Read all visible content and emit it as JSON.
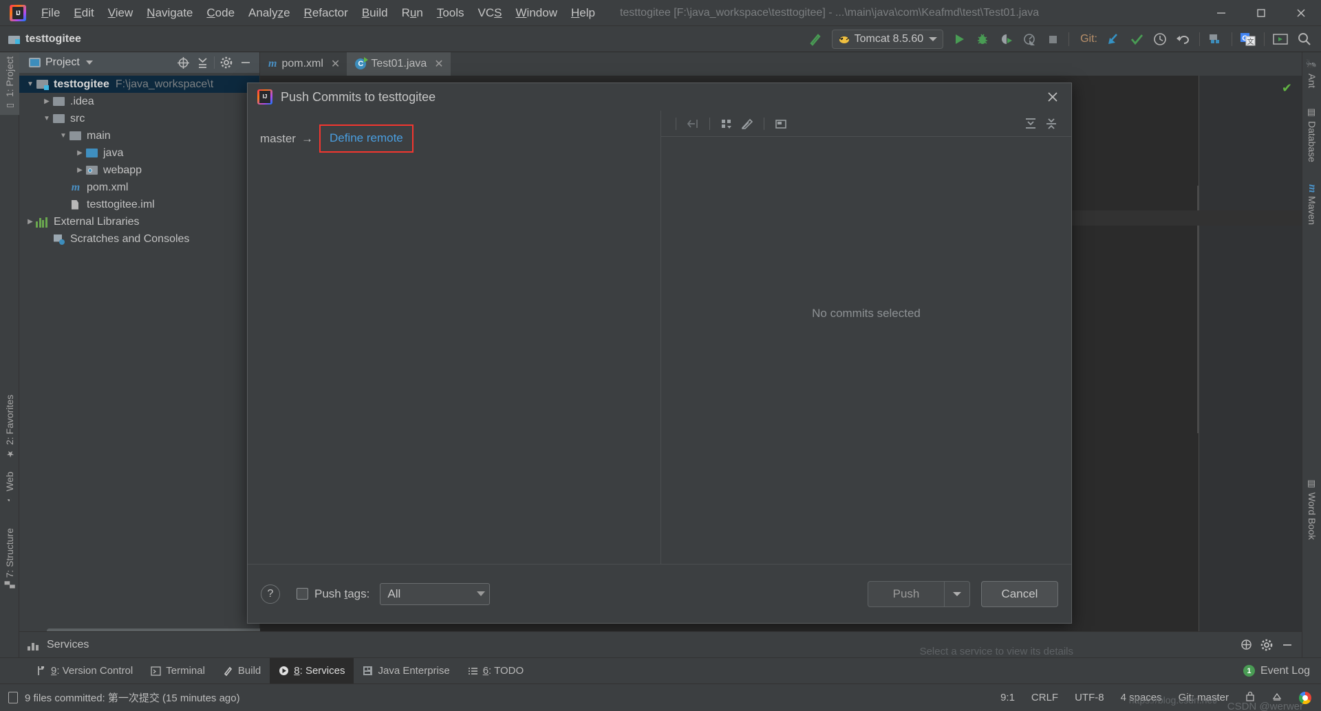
{
  "menu": {
    "items": [
      {
        "label": "File",
        "mn": "F"
      },
      {
        "label": "Edit",
        "mn": "E"
      },
      {
        "label": "View",
        "mn": "V"
      },
      {
        "label": "Navigate",
        "mn": "N"
      },
      {
        "label": "Code",
        "mn": "C"
      },
      {
        "label": "Analyze",
        "mn": "z"
      },
      {
        "label": "Refactor",
        "mn": "R"
      },
      {
        "label": "Build",
        "mn": "B"
      },
      {
        "label": "Run",
        "mn": "u"
      },
      {
        "label": "Tools",
        "mn": "T"
      },
      {
        "label": "VCS",
        "mn": "S"
      },
      {
        "label": "Window",
        "mn": "W"
      },
      {
        "label": "Help",
        "mn": "H"
      }
    ],
    "window_title": "testtogitee [F:\\java_workspace\\testtogitee] - ...\\main\\java\\com\\Keafmd\\test\\Test01.java",
    "window_controls": [
      "minimize",
      "maximize",
      "close"
    ]
  },
  "toolbar": {
    "project_name": "testtogitee",
    "run_config": "Tomcat 8.5.60",
    "git_label": "Git:",
    "icons": [
      "build-icon",
      "run-icon",
      "debug-icon",
      "run-coverage-icon",
      "profile-icon",
      "stop-icon"
    ],
    "git_icons": [
      "update-project-icon",
      "commit-icon",
      "history-icon",
      "undo-icon"
    ],
    "right_icons": [
      "project-structure-icon",
      "translate-icon",
      "terminal-icon",
      "search-icon"
    ]
  },
  "left_stripe": [
    {
      "label": "1: Project",
      "icon": "project-icon",
      "selected": true
    },
    {
      "label": "2: Favorites",
      "icon": "star-icon",
      "selected": false
    },
    {
      "label": "Web",
      "icon": "web-icon",
      "selected": false
    },
    {
      "label": "7: Structure",
      "icon": "structure-icon",
      "selected": false
    }
  ],
  "right_stripe": [
    {
      "label": "Ant",
      "icon": "ant-icon"
    },
    {
      "label": "Database",
      "icon": "database-icon"
    },
    {
      "label": "Maven",
      "icon": "maven-icon"
    },
    {
      "label": "Word Book",
      "icon": "wordbook-icon"
    }
  ],
  "project_panel": {
    "header_title": "Project",
    "header_icons": [
      "locate-icon",
      "collapse-all-icon",
      "settings-icon",
      "hide-icon"
    ],
    "tree": [
      {
        "label": "testtogitee",
        "path": "F:\\java_workspace\\t",
        "indent": 0,
        "arrow": "down",
        "icon": "project-folder-icon",
        "bold": true,
        "selected": true
      },
      {
        "label": ".idea",
        "path": "",
        "indent": 1,
        "arrow": "right",
        "icon": "folder-icon",
        "bold": false,
        "selected": false
      },
      {
        "label": "src",
        "path": "",
        "indent": 1,
        "arrow": "down",
        "icon": "folder-icon",
        "bold": false,
        "selected": false
      },
      {
        "label": "main",
        "path": "",
        "indent": 2,
        "arrow": "down",
        "icon": "folder-icon",
        "bold": false,
        "selected": false
      },
      {
        "label": "java",
        "path": "",
        "indent": 3,
        "arrow": "right",
        "icon": "source-folder-icon",
        "bold": false,
        "selected": false
      },
      {
        "label": "webapp",
        "path": "",
        "indent": 3,
        "arrow": "right",
        "icon": "webapp-folder-icon",
        "bold": false,
        "selected": false
      },
      {
        "label": "pom.xml",
        "path": "",
        "indent": 2,
        "arrow": "none",
        "icon": "maven-file-icon",
        "bold": false,
        "selected": false
      },
      {
        "label": "testtogitee.iml",
        "path": "",
        "indent": 2,
        "arrow": "none",
        "icon": "iml-file-icon",
        "bold": false,
        "selected": false
      },
      {
        "label": "External Libraries",
        "path": "",
        "indent": 0,
        "arrow": "right",
        "icon": "libraries-icon",
        "bold": false,
        "selected": false
      },
      {
        "label": "Scratches and Consoles",
        "path": "",
        "indent": 0,
        "arrow": "none",
        "icon": "scratches-icon",
        "bold": false,
        "selected": false
      }
    ]
  },
  "editor": {
    "tabs": [
      {
        "label": "pom.xml",
        "icon": "maven-file-icon",
        "active": false
      },
      {
        "label": "Test01.java",
        "icon": "java-class-icon",
        "active": true
      }
    ]
  },
  "dialog": {
    "title": "Push Commits to testtogitee",
    "close_icon": "close-icon",
    "branch_source": "master",
    "branch_arrow": "→",
    "define_remote_link": "Define remote",
    "commit_toolbar_icons": [
      "collapse-selection-icon",
      "grid-icon",
      "edit-icon",
      "preview-icon",
      "expand-all-icon",
      "collapse-all-icon"
    ],
    "empty_message": "No commits selected",
    "help_label": "?",
    "push_tags_label": "Push tags:",
    "push_tags_mnemonic": "t",
    "push_tags_checked": false,
    "tags_scope": "All",
    "push_button": "Push",
    "cancel_button": "Cancel",
    "highlight_color": "#f4362f",
    "link_color": "#4a9ee0"
  },
  "services_panel": {
    "title": "Services",
    "icons": [
      "add-icon",
      "settings-icon",
      "hide-icon"
    ],
    "hint": "Select a service to view its details"
  },
  "tool_tabs": [
    {
      "label": "9: Version Control",
      "mn": "9",
      "icon": "branch-icon",
      "selected": false
    },
    {
      "label": "Terminal",
      "mn": "",
      "icon": "terminal-icon",
      "selected": false
    },
    {
      "label": "Build",
      "mn": "",
      "icon": "build-icon",
      "selected": false
    },
    {
      "label": "8: Services",
      "mn": "8",
      "icon": "services-icon",
      "selected": true
    },
    {
      "label": "Java Enterprise",
      "mn": "",
      "icon": "java-enterprise-icon",
      "selected": false
    },
    {
      "label": "6: TODO",
      "mn": "6",
      "icon": "todo-icon",
      "selected": false
    }
  ],
  "event_log": {
    "count": "1",
    "label": "Event Log"
  },
  "status_bar": {
    "message": "9 files committed: 第一次提交 (15 minutes ago)",
    "caret": "9:1",
    "line_sep": "CRLF",
    "encoding": "UTF-8",
    "indent": "4 spaces",
    "branch": "Git: master",
    "watermark": "CSDN @werwer",
    "watermark2": "https://blog.csdn.net/"
  }
}
